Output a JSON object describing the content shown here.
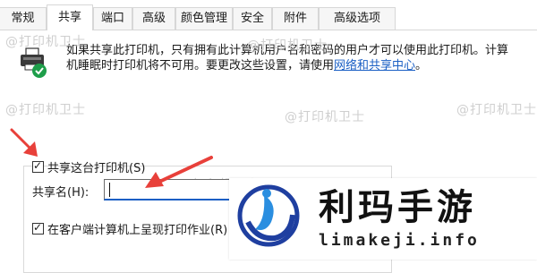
{
  "tabs": [
    "常规",
    "共享",
    "端口",
    "高级",
    "颜色管理",
    "安全",
    "附件",
    "高级选项"
  ],
  "active_tab": "共享",
  "description": {
    "text": "如果共享此打印机，只有拥有此计算机用户名和密码的用户才可以使用此打印机。计算机睡眠时打印机将不可用。要更改这些设置，请使用",
    "link": "网络和共享中心",
    "suffix": "。"
  },
  "share_printer": {
    "label": "共享这台打印机(S)",
    "checked": true
  },
  "share_name": {
    "label": "共享名(H):",
    "value": ""
  },
  "render_client": {
    "label": "在客户端计算机上呈现打印作业(R)",
    "checked": true
  },
  "watermarks": [
    "@打印机卫士",
    "@打印机卫士",
    "@打印机卫士",
    "@打印机卫士",
    "@打印机卫士",
    "@打印机卫士"
  ],
  "logo": {
    "title": "利玛手游",
    "domain": "limakeji.info"
  },
  "colors": {
    "accent": "#1a5fc4",
    "arrow": "#e8403a",
    "check_badge": "#1e9e4a"
  }
}
